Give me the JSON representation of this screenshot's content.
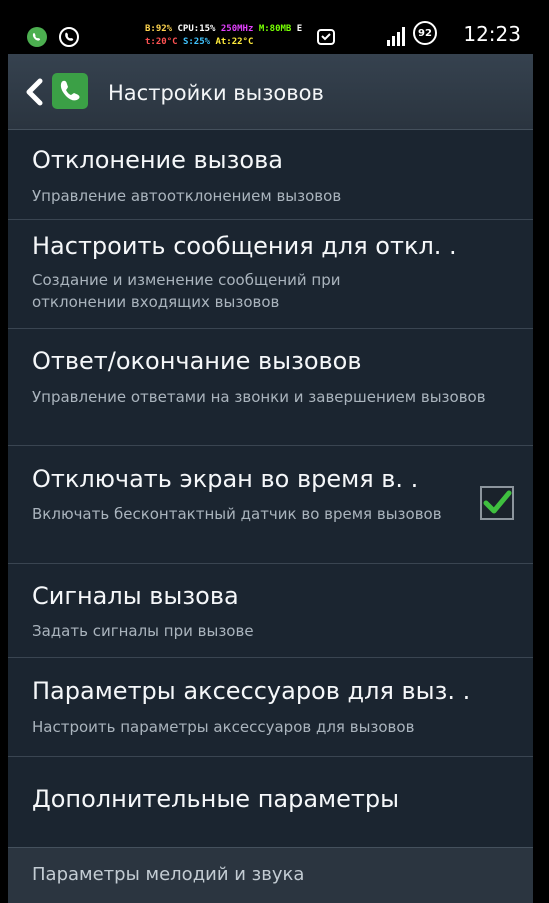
{
  "status_bar": {
    "sys_line1": [
      "B:92%",
      "CPU:15%",
      "250MHz",
      "M:80MB",
      "E"
    ],
    "sys_line2": [
      "t:20°C",
      "S:25%",
      "At:22°C"
    ],
    "battery": "92",
    "time": "12:23",
    "icons": [
      "whatsapp-icon",
      "phone-call-icon",
      "voicemail-icon",
      "signal-icon",
      "battery-icon"
    ]
  },
  "action_bar": {
    "title": "Настройки вызовов"
  },
  "settings": [
    {
      "title": "Отклонение вызова",
      "summary": "Управление автоотклонением вызовов"
    },
    {
      "title": "Настроить сообщения для откл. .",
      "summary": "Создание и изменение сообщений при отклонении входящих вызовов"
    },
    {
      "title": "Ответ/окончание вызовов",
      "summary": "Управление ответами на звонки и завершением вызовов"
    },
    {
      "title": "Отключать экран во время в. .",
      "summary": "Включать бесконтактный датчик во время вызовов",
      "checked": true
    },
    {
      "title": "Сигналы вызова",
      "summary": "Задать сигналы при вызове"
    },
    {
      "title": "Параметры аксессуаров для выз. .",
      "summary": "Настроить параметры аксессуаров для вызовов"
    },
    {
      "title": "Дополнительные параметры"
    }
  ],
  "section_header": "Параметры мелодий и звука",
  "colors": {
    "background": "#1b2530",
    "check_accent": "#3fbf3f",
    "app_icon": "#3ba046"
  }
}
